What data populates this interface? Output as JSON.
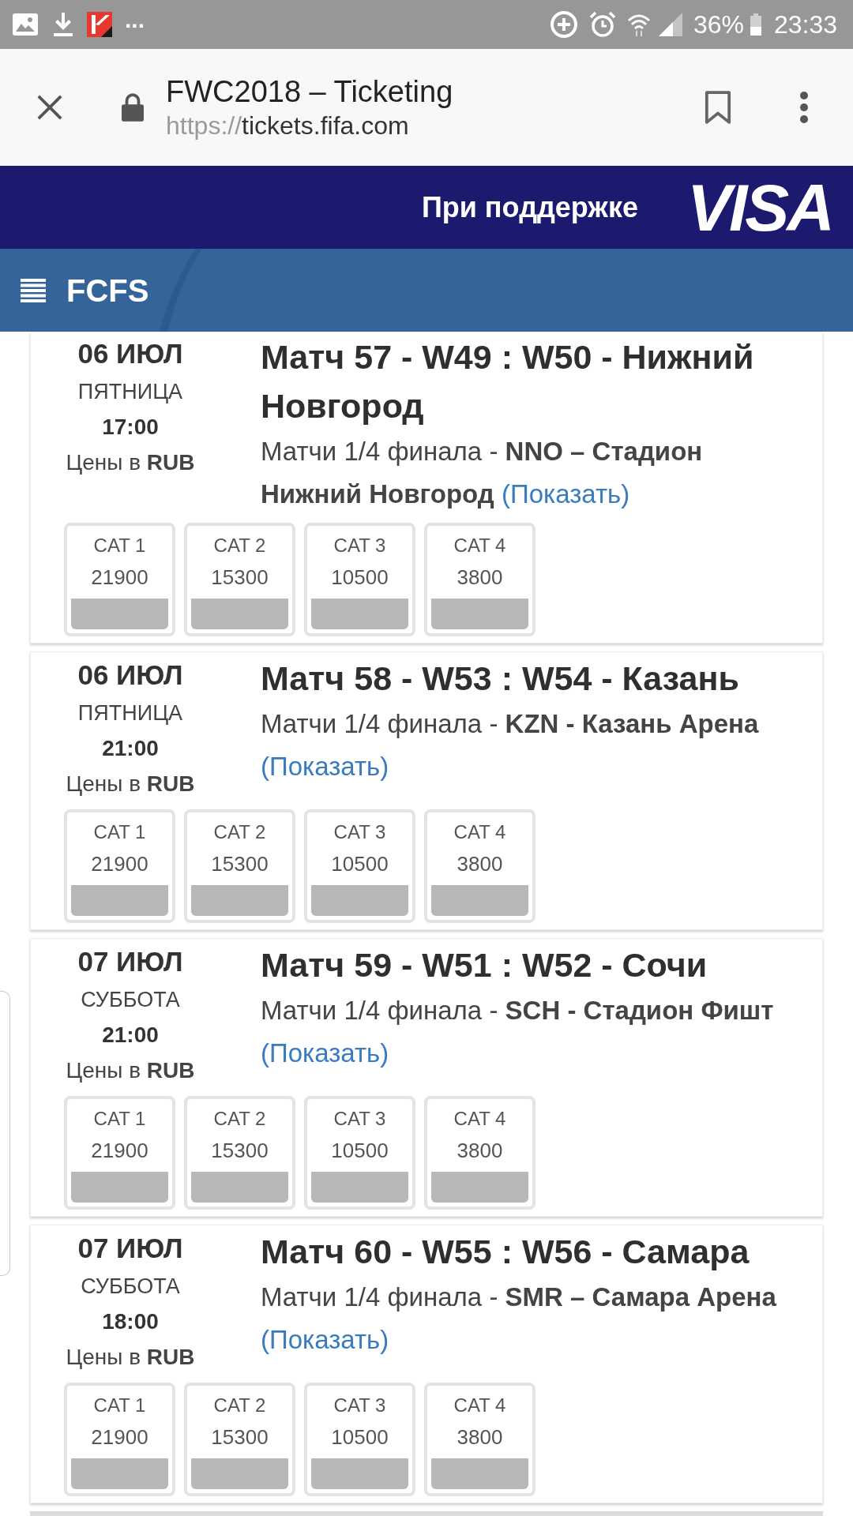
{
  "status_bar": {
    "overflow": "...",
    "battery": "36%",
    "time": "23:33"
  },
  "browser": {
    "title": "FWC2018 – Ticketing",
    "url": {
      "scheme": "https://",
      "host": "tickets.fifa.com"
    }
  },
  "sponsor_band": {
    "label": "При поддержке",
    "logo": "VISA"
  },
  "nav_bar": {
    "title": "FCFS"
  },
  "matches": [
    {
      "date": "06 ИЮЛ",
      "weekday": "ПЯТНИЦА",
      "time": "17:00",
      "currency": "Цены в **RUB**",
      "title": "Матч 57 - W49 : W50 - Нижний Новгород",
      "venue": "Матчи 1/4 финала - **NNO – Стадион Нижний Новгород**",
      "link": "(Показать)",
      "categories": [
        {
          "label": "CAT 1",
          "price": "21900"
        },
        {
          "label": "CAT 2",
          "price": "15300"
        },
        {
          "label": "CAT 3",
          "price": "10500"
        },
        {
          "label": "CAT 4",
          "price": "3800"
        }
      ]
    },
    {
      "date": "06 ИЮЛ",
      "weekday": "ПЯТНИЦА",
      "time": "21:00",
      "currency": "Цены в **RUB**",
      "title": "Матч 58 - W53 : W54 - Казань",
      "venue": "Матчи 1/4 финала - **KZN - Казань Арена**",
      "link": "(Показать)",
      "categories": [
        {
          "label": "CAT 1",
          "price": "21900"
        },
        {
          "label": "CAT 2",
          "price": "15300"
        },
        {
          "label": "CAT 3",
          "price": "10500"
        },
        {
          "label": "CAT 4",
          "price": "3800"
        }
      ]
    },
    {
      "date": "07 ИЮЛ",
      "weekday": "СУББОТА",
      "time": "21:00",
      "currency": "Цены в **RUB**",
      "title": "Матч 59 - W51 : W52 - Сочи",
      "venue": "Матчи 1/4 финала - **SCH - Стадион Фишт**",
      "link": "(Показать)",
      "categories": [
        {
          "label": "CAT 1",
          "price": "21900"
        },
        {
          "label": "CAT 2",
          "price": "15300"
        },
        {
          "label": "CAT 3",
          "price": "10500"
        },
        {
          "label": "CAT 4",
          "price": "3800"
        }
      ]
    },
    {
      "date": "07 ИЮЛ",
      "weekday": "СУББОТА",
      "time": "18:00",
      "currency": "Цены в **RUB**",
      "title": "Матч 60 - W55 : W56 - Самара",
      "venue": "Матчи 1/4 финала - **SMR – Самара Арена**",
      "link": "(Показать)",
      "categories": [
        {
          "label": "CAT 1",
          "price": "21900"
        },
        {
          "label": "CAT 2",
          "price": "15300"
        },
        {
          "label": "CAT 3",
          "price": "10500"
        },
        {
          "label": "CAT 4",
          "price": "3800"
        }
      ]
    }
  ]
}
